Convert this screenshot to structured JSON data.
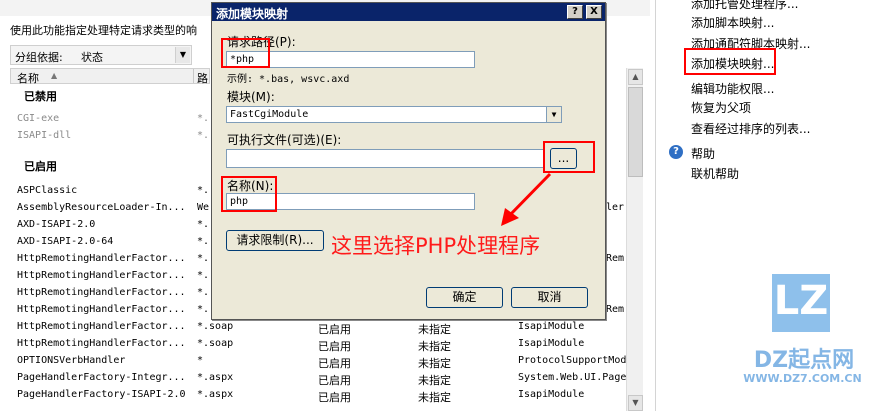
{
  "background": {
    "description": "使用此功能指定处理特定请求类型的响",
    "group_by_label": "分组依据:",
    "group_by_value": "状态",
    "columns": [
      "名称",
      "路"
    ],
    "group_disabled": "已禁用",
    "group_enabled": "已启用",
    "disabled_rows": [
      [
        "CGI-exe",
        "*."
      ],
      [
        "ISAPI-dll",
        "*."
      ]
    ],
    "enabled_rows": [
      [
        "ASPClassic",
        "*.",
        "",
        "",
        ""
      ],
      [
        "AssemblyResourceLoader-In...",
        "We",
        "",
        "",
        "ler"
      ],
      [
        "AXD-ISAPI-2.0",
        "*.",
        "",
        "",
        ""
      ],
      [
        "AXD-ISAPI-2.0-64",
        "*.",
        "",
        "",
        ""
      ],
      [
        "HttpRemotingHandlerFactor...",
        "*.",
        "",
        "",
        "Rem"
      ],
      [
        "HttpRemotingHandlerFactor...",
        "*.",
        "",
        "",
        ""
      ],
      [
        "HttpRemotingHandlerFactor...",
        "*.",
        "",
        "",
        ""
      ],
      [
        "HttpRemotingHandlerFactor...",
        "*.",
        "",
        "",
        "Rem"
      ],
      [
        "HttpRemotingHandlerFactor...",
        "*.soap",
        "已启用",
        "未指定",
        "IsapiModule"
      ],
      [
        "HttpRemotingHandlerFactor...",
        "*.soap",
        "已启用",
        "未指定",
        "IsapiModule"
      ],
      [
        "OPTIONSVerbHandler",
        "*",
        "已启用",
        "未指定",
        "ProtocolSupportMod"
      ],
      [
        "PageHandlerFactory-Integr...",
        "*.aspx",
        "已启用",
        "未指定",
        "System.Web.UI.Page"
      ],
      [
        "PageHandlerFactory-ISAPI-2.0",
        "*.aspx",
        "已启用",
        "未指定",
        "IsapiModule"
      ]
    ]
  },
  "actions": {
    "items": [
      "添加托管处理程序...",
      "添加脚本映射...",
      "添加通配符脚本映射...",
      "添加模块映射...",
      "编辑功能权限...",
      "恢复为父项",
      "查看经过排序的列表...",
      "帮助",
      "联机帮助"
    ]
  },
  "dialog": {
    "title": "添加模块映射",
    "help_btn": "?",
    "close_btn": "X",
    "request_path_label": "请求路径(P):",
    "request_path_value": "*php",
    "example_text": "示例: *.bas, wsvc.axd",
    "module_label": "模块(M):",
    "module_value": "FastCgiModule",
    "executable_label": "可执行文件(可选)(E):",
    "executable_value": "",
    "browse_label": "...",
    "name_label": "名称(N):",
    "name_value": "php",
    "restrictions_label": "请求限制(R)...",
    "ok_label": "确定",
    "cancel_label": "取消"
  },
  "annotation": "这里选择PHP处理程序",
  "watermark": {
    "logo_text": "LZ",
    "site_name": "DZ起点网",
    "site_url": "WWW.DZ7.COM.CN"
  },
  "colors": {
    "highlight": "#ff0000",
    "dialog_title_bg": "#0a246a",
    "dialog_bg": "#ece9d8",
    "logo_blue": "#4a9adf"
  }
}
